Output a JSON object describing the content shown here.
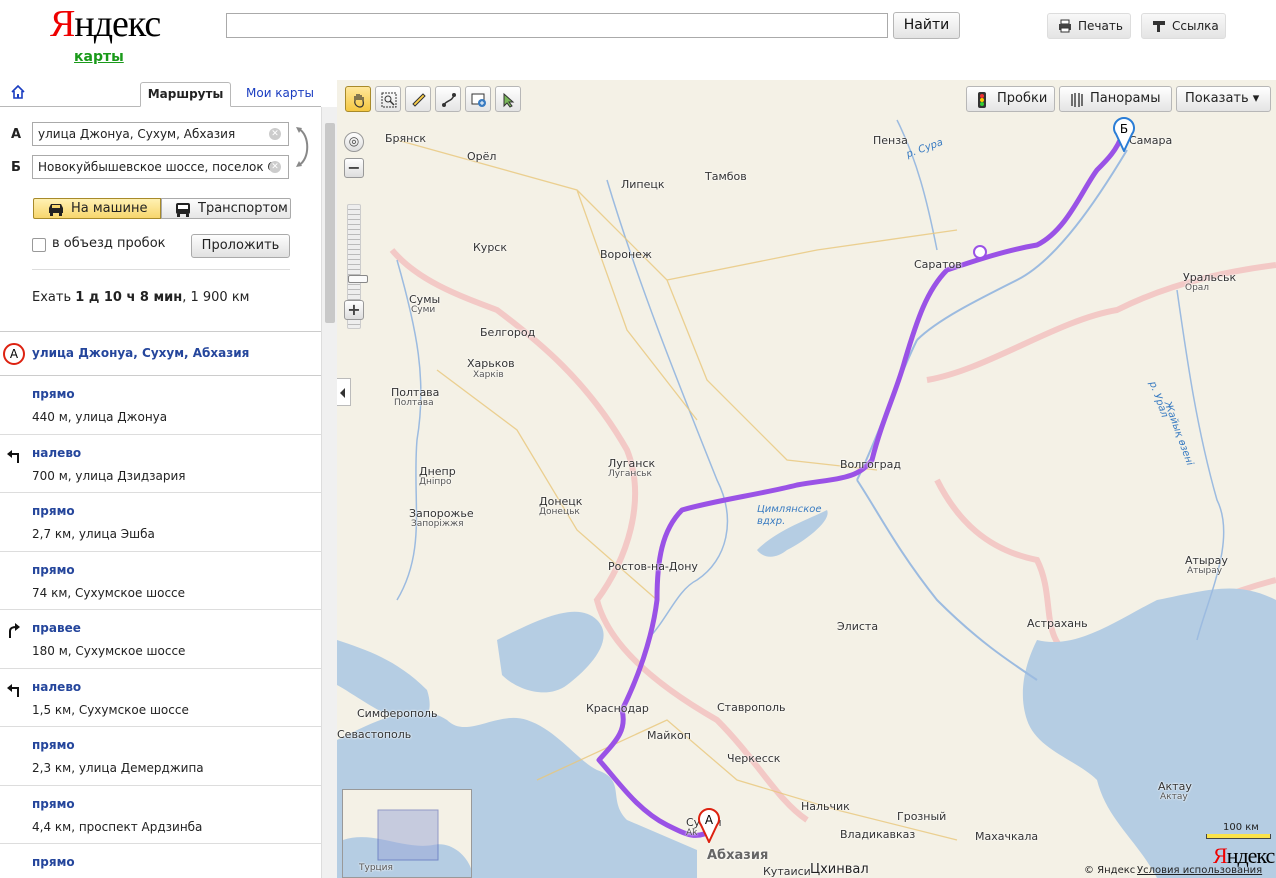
{
  "header": {
    "logo": "Яндекс",
    "logo_sub": "карты",
    "search_value": "",
    "search_button": "Найти",
    "print_label": "Печать",
    "link_label": "Ссылка"
  },
  "sidebar": {
    "tabs": {
      "routes": "Маршруты",
      "mymaps": "Мои карты"
    },
    "point_a_label": "А",
    "point_a_value": "улица Джонуа, Сухум, Абхазия",
    "point_b_label": "Б",
    "point_b_value": "Новокуйбышевское шоссе, поселок С",
    "mode_car": "На машине",
    "mode_transit": "Транспортом",
    "avoid_traffic": "в объезд пробок",
    "build_button": "Проложить",
    "summary_prefix": "Ехать",
    "summary_time": "1 д 10 ч 8 мин",
    "summary_dist": ", 1 900 км",
    "start_marker": "А",
    "start_label": "улица Джонуа, Сухум, Абхазия",
    "steps": [
      {
        "dir": "прямо",
        "detail": "440 м, улица Джонуа",
        "turn": "straight"
      },
      {
        "dir": "налево",
        "detail": "700 м, улица Дзидзария",
        "turn": "left"
      },
      {
        "dir": "прямо",
        "detail": "2,7 км, улица Эшба",
        "turn": "straight"
      },
      {
        "dir": "прямо",
        "detail": "74 км, Сухумское шоссе",
        "turn": "straight"
      },
      {
        "dir": "правее",
        "detail": "180 м, Сухумское шоссе",
        "turn": "right"
      },
      {
        "dir": "налево",
        "detail": "1,5 км, Сухумское шоссе",
        "turn": "left"
      },
      {
        "dir": "прямо",
        "detail": "2,3 км, улица Демерджипа",
        "turn": "straight"
      },
      {
        "dir": "прямо",
        "detail": "4,4 км, проспект Ардзинба",
        "turn": "straight"
      },
      {
        "dir": "прямо",
        "detail": "",
        "turn": "straight"
      }
    ]
  },
  "map": {
    "buttons": {
      "traffic": "Пробки",
      "panoramas": "Панорамы",
      "show": "Показать ▾"
    },
    "pin_a": "А",
    "pin_b": "Б",
    "scale": "100 км",
    "logo": "Яндекс",
    "copyright": "© Яндекс",
    "terms": "Условия использования",
    "route_color": "#9a52e6",
    "cities": {
      "bryansk": "Брянск",
      "orel": "Орёл",
      "lipetsk": "Липецк",
      "tambov": "Тамбов",
      "penza": "Пенза",
      "samara": "Самара",
      "kursk": "Курск",
      "voronezh": "Воронеж",
      "saratov": "Саратов",
      "uralsk": "Уральськ",
      "oral": "Орал",
      "sumy": "Сумы",
      "sumy2": "Суми",
      "belgorod": "Белгород",
      "kharkov": "Харьков",
      "kharkiv": "Харків",
      "poltava": "Полтава",
      "poltava2": "Полтава",
      "lugansk": "Луганск",
      "lugansk2": "Луганськ",
      "volgograd": "Волгоград",
      "dnepr": "Днепр",
      "dnipro": "Дніпро",
      "donetsk": "Донецк",
      "donetsk2": "Донецьк",
      "zaporozhye": "Запорожье",
      "zaporizhzhia": "Запоріжжя",
      "rostov": "Ростов-на-Дону",
      "atyrau": "Атырау",
      "atyrau2": "Атырау",
      "elista": "Элиста",
      "astrakhan": "Астрахань",
      "simferopol": "Симферополь",
      "sevastopol": "Севастополь",
      "krasnodar": "Краснодар",
      "maykop": "Майкоп",
      "stavropol": "Ставрополь",
      "cherkessk": "Черкесск",
      "nalchik": "Нальчик",
      "grozny": "Грозный",
      "vladikavkaz": "Владикавказ",
      "makhachkala": "Махачкала",
      "aktau": "Актау",
      "aktau2": "Актау",
      "kutaisi": "Кутаиси",
      "tskhinval": "Цхинвал",
      "abkhazia": "Абхазия",
      "turkey": "Турция",
      "sukhum": "Сухум",
      "sukhum2": "Аҟ"
    },
    "rivers": {
      "sura": "р. Сура",
      "tsimlyansk": "Цимлянское",
      "tsimlyansk2": "вдхр.",
      "ural": "р. Урал",
      "zhaiyk": "Жайық өзені"
    }
  }
}
